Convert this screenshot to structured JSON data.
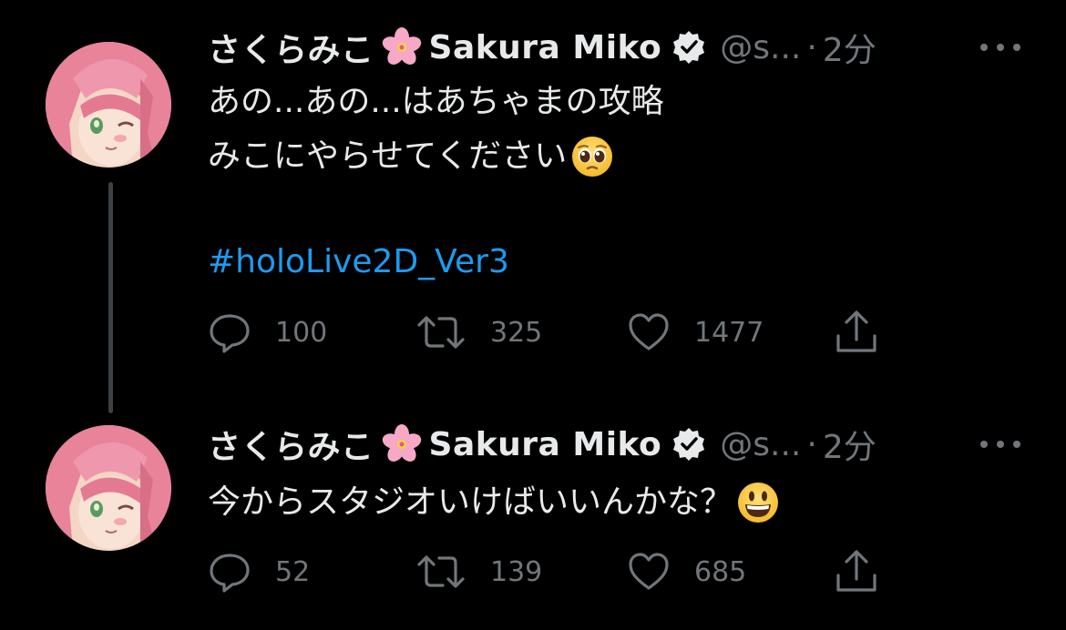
{
  "tweets": [
    {
      "display_name": "さくらみこ",
      "display_name_suffix": "Sakura Miko",
      "handle": "@s...",
      "separator": "·",
      "time": "2分",
      "text_lines": [
        "あの...あの...はあちゃまの攻略",
        "みこにやらせてください"
      ],
      "hashtag": "#holoLive2D_Ver3",
      "replies": "100",
      "retweets": "325",
      "likes": "1477",
      "emoji": "pleading-face-emoji"
    },
    {
      "display_name": "さくらみこ",
      "display_name_suffix": "Sakura Miko",
      "handle": "@s...",
      "separator": "·",
      "time": "2分",
      "text_lines": [
        "今からスタジオいけばいいんかな？"
      ],
      "replies": "52",
      "retweets": "139",
      "likes": "685",
      "emoji": "grinning-face-emoji"
    }
  ],
  "colors": {
    "background": "#000000",
    "primary_text": "#e7e9ea",
    "secondary_text": "#71767b",
    "link": "#1d9bf0",
    "thread_line": "#3e4144"
  },
  "icons": [
    "cherry-blossom-icon",
    "verified-badge-icon",
    "more-icon",
    "reply-icon",
    "retweet-icon",
    "like-icon",
    "share-icon"
  ]
}
